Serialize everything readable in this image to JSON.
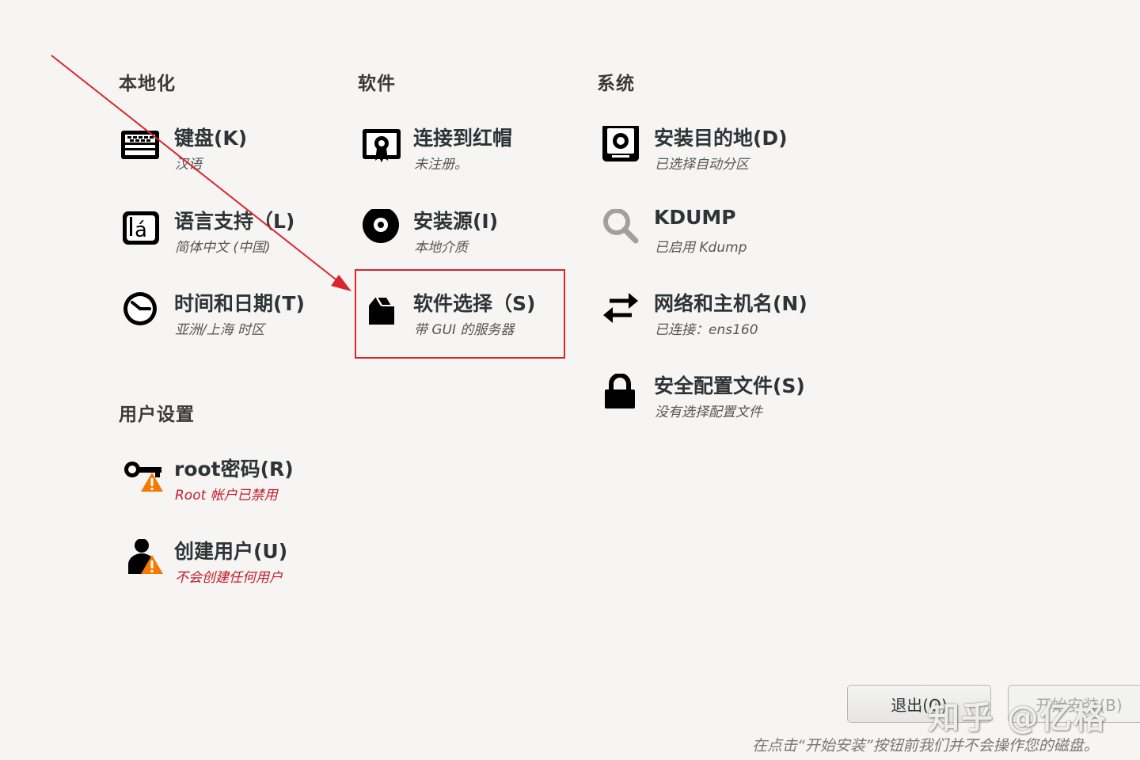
{
  "sections": {
    "localization": "本地化",
    "software": "软件",
    "system": "系统",
    "user_settings": "用户设置"
  },
  "spokes": {
    "keyboard": {
      "title": "键盘(K)",
      "status": "汉语",
      "icon": "keyboard-icon"
    },
    "language": {
      "title": "语言支持（L)",
      "status": "简体中文 (中国)",
      "icon": "language-icon"
    },
    "datetime": {
      "title": "时间和日期(T)",
      "status": "亚洲/上海 时区",
      "icon": "clock-icon"
    },
    "connect_redhat": {
      "title": "连接到红帽",
      "status": "未注册。",
      "icon": "redhat-certificate-icon"
    },
    "install_source": {
      "title": "安装源(I)",
      "status": "本地介质",
      "icon": "disc-icon"
    },
    "software_selection": {
      "title": "软件选择（S)",
      "status": "带 GUI 的服务器",
      "icon": "package-icon"
    },
    "install_destination": {
      "title": "安装目的地(D)",
      "status": "已选择自动分区",
      "icon": "hard-disk-icon"
    },
    "kdump": {
      "title": "KDUMP",
      "status": "已启用 Kdump",
      "icon": "search-icon"
    },
    "network": {
      "title": "网络和主机名(N)",
      "status": "已连接：ens160",
      "icon": "network-arrows-icon"
    },
    "security": {
      "title": "安全配置文件(S)",
      "status": "没有选择配置文件",
      "icon": "lock-icon"
    },
    "root_password": {
      "title": "root密码(R)",
      "status": "Root 帐户已禁用",
      "icon": "key-warning-icon",
      "warning": true
    },
    "create_user": {
      "title": "创建用户(U)",
      "status": "不会创建任何用户",
      "icon": "user-warning-icon",
      "warning": true
    }
  },
  "buttons": {
    "quit": "退出(Q)",
    "begin_install": "开始安装(B)"
  },
  "footer_note": "在点击“开始安装”按钮前我们并不会操作您的磁盘。",
  "watermark": "知乎 @亿格",
  "colors": {
    "background": "#f6f5f4",
    "warning_text": "#c01c28",
    "annotation_red": "#d7262c",
    "warning_badge": "#f57900"
  }
}
